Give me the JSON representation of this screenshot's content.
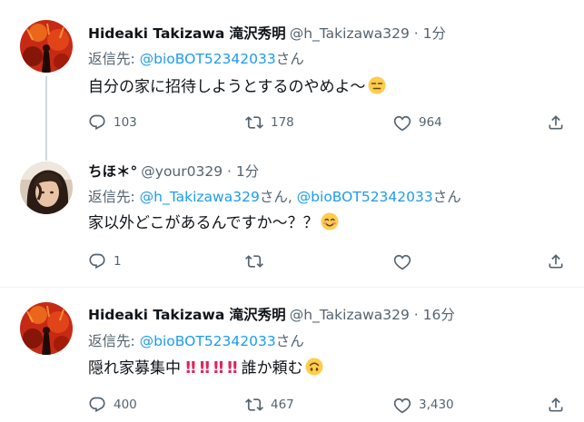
{
  "tweets": [
    {
      "name": "Hideaki Takizawa 滝沢秀明",
      "handle": "@h_Takizawa329",
      "dot": "·",
      "time": "1分",
      "reply_prefix": "返信先: ",
      "mentions": [
        "@bioBOT52342033"
      ],
      "mention_separator": "",
      "reply_suffix": "さん",
      "text": "自分の家に招待しようとするのやめよ〜",
      "emoji": "expressionless-face-emoji",
      "counts": {
        "reply": "103",
        "retweet": "178",
        "like": "964"
      }
    },
    {
      "name": "ちほ＊°",
      "handle": "@your0329",
      "dot": "·",
      "time": "1分",
      "reply_prefix": "返信先: ",
      "mentions": [
        "@h_Takizawa329",
        "@bioBOT52342033"
      ],
      "mention_separator": "さん, ",
      "reply_suffix": "さん",
      "text": "家以外どこがあるんですか〜？？",
      "emoji": "smiling-blushing-face-emoji",
      "counts": {
        "reply": "1",
        "retweet": "",
        "like": ""
      }
    },
    {
      "name": "Hideaki Takizawa 滝沢秀明",
      "handle": "@h_Takizawa329",
      "dot": "·",
      "time": "16分",
      "reply_prefix": "返信先: ",
      "mentions": [
        "@bioBOT52342033"
      ],
      "mention_separator": "",
      "reply_suffix": "さん",
      "text": "隠れ家募集中",
      "bangs": [
        "‼",
        "‼",
        "‼",
        "‼"
      ],
      "text_after": "誰か頼む",
      "emoji": "upside-down-face-emoji",
      "counts": {
        "reply": "400",
        "retweet": "467",
        "like": "3,430"
      }
    }
  ],
  "icons": {
    "reply": "reply-bubble-icon",
    "retweet": "retweet-arrows-icon",
    "like": "heart-outline-icon",
    "share": "share-upload-icon"
  },
  "colors": {
    "text": "#0f1419",
    "secondary": "#536471",
    "link": "#1d9bf0",
    "divider": "#eff3f4",
    "thread_line": "#cfd9de",
    "bang": "#e0245e",
    "emoji_yellow": "#ffcc4d"
  }
}
